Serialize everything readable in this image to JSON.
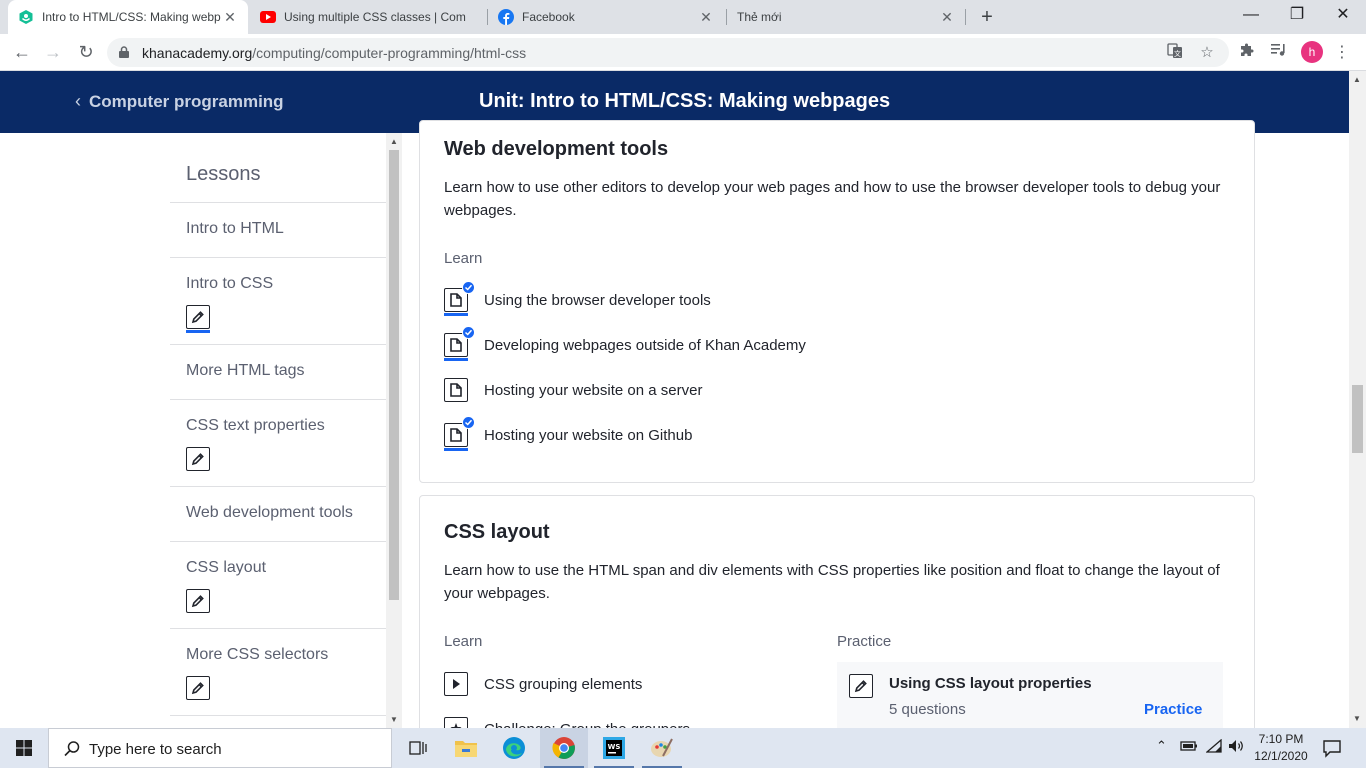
{
  "browser": {
    "tabs": [
      {
        "title": "Intro to HTML/CSS: Making webp",
        "icon": "khan-academy-icon",
        "active": true
      },
      {
        "title": "Using multiple CSS classes | Com",
        "icon": "youtube-icon",
        "active": false
      },
      {
        "title": "Facebook",
        "icon": "facebook-icon",
        "active": false
      },
      {
        "title": "Thẻ mới",
        "icon": "",
        "active": false
      }
    ],
    "url_host": "khanacademy.org",
    "url_path": "/computing/computer-programming/html-css",
    "profile_initial": "h"
  },
  "header": {
    "back_label": "Computer programming",
    "unit_title": "Unit: Intro to HTML/CSS: Making webpages"
  },
  "sidebar": {
    "heading": "Lessons",
    "items": [
      {
        "label": "Intro to HTML",
        "has_practice": false
      },
      {
        "label": "Intro to CSS",
        "has_practice": true,
        "practice_done": true
      },
      {
        "label": "More HTML tags",
        "has_practice": false
      },
      {
        "label": "CSS text properties",
        "has_practice": true,
        "practice_done": false
      },
      {
        "label": "Web development tools",
        "has_practice": false
      },
      {
        "label": "CSS layout",
        "has_practice": true,
        "practice_done": false
      },
      {
        "label": "More CSS selectors",
        "has_practice": true,
        "practice_done": false
      }
    ]
  },
  "sections": [
    {
      "title": "Web development tools",
      "description": "Learn how to use other editors to develop your web pages and how to use the browser developer tools to debug your webpages.",
      "learn_label": "Learn",
      "items": [
        {
          "label": "Using the browser developer tools",
          "type": "article",
          "completed": true
        },
        {
          "label": "Developing webpages outside of Khan Academy",
          "type": "article",
          "completed": true
        },
        {
          "label": "Hosting your website on a server",
          "type": "article",
          "completed": false
        },
        {
          "label": "Hosting your website on Github",
          "type": "article",
          "completed": true
        }
      ]
    },
    {
      "title": "CSS layout",
      "description": "Learn how to use the HTML span and div elements with CSS properties like position and float to change the layout of your webpages.",
      "learn_label": "Learn",
      "practice_label": "Practice",
      "items": [
        {
          "label": "CSS grouping elements",
          "type": "video",
          "completed": false
        },
        {
          "label": "Challenge: Group the groupers",
          "type": "challenge",
          "completed": false
        }
      ],
      "practice": {
        "title": "Using CSS layout properties",
        "count": "5 questions",
        "action": "Practice"
      }
    }
  ],
  "taskbar": {
    "search_placeholder": "Type here to search",
    "time": "7:10 PM",
    "date": "12/1/2020"
  },
  "colors": {
    "header_bg": "#0a2a66",
    "accent": "#1865f2",
    "text": "#21242c",
    "muted": "#5b6070"
  }
}
